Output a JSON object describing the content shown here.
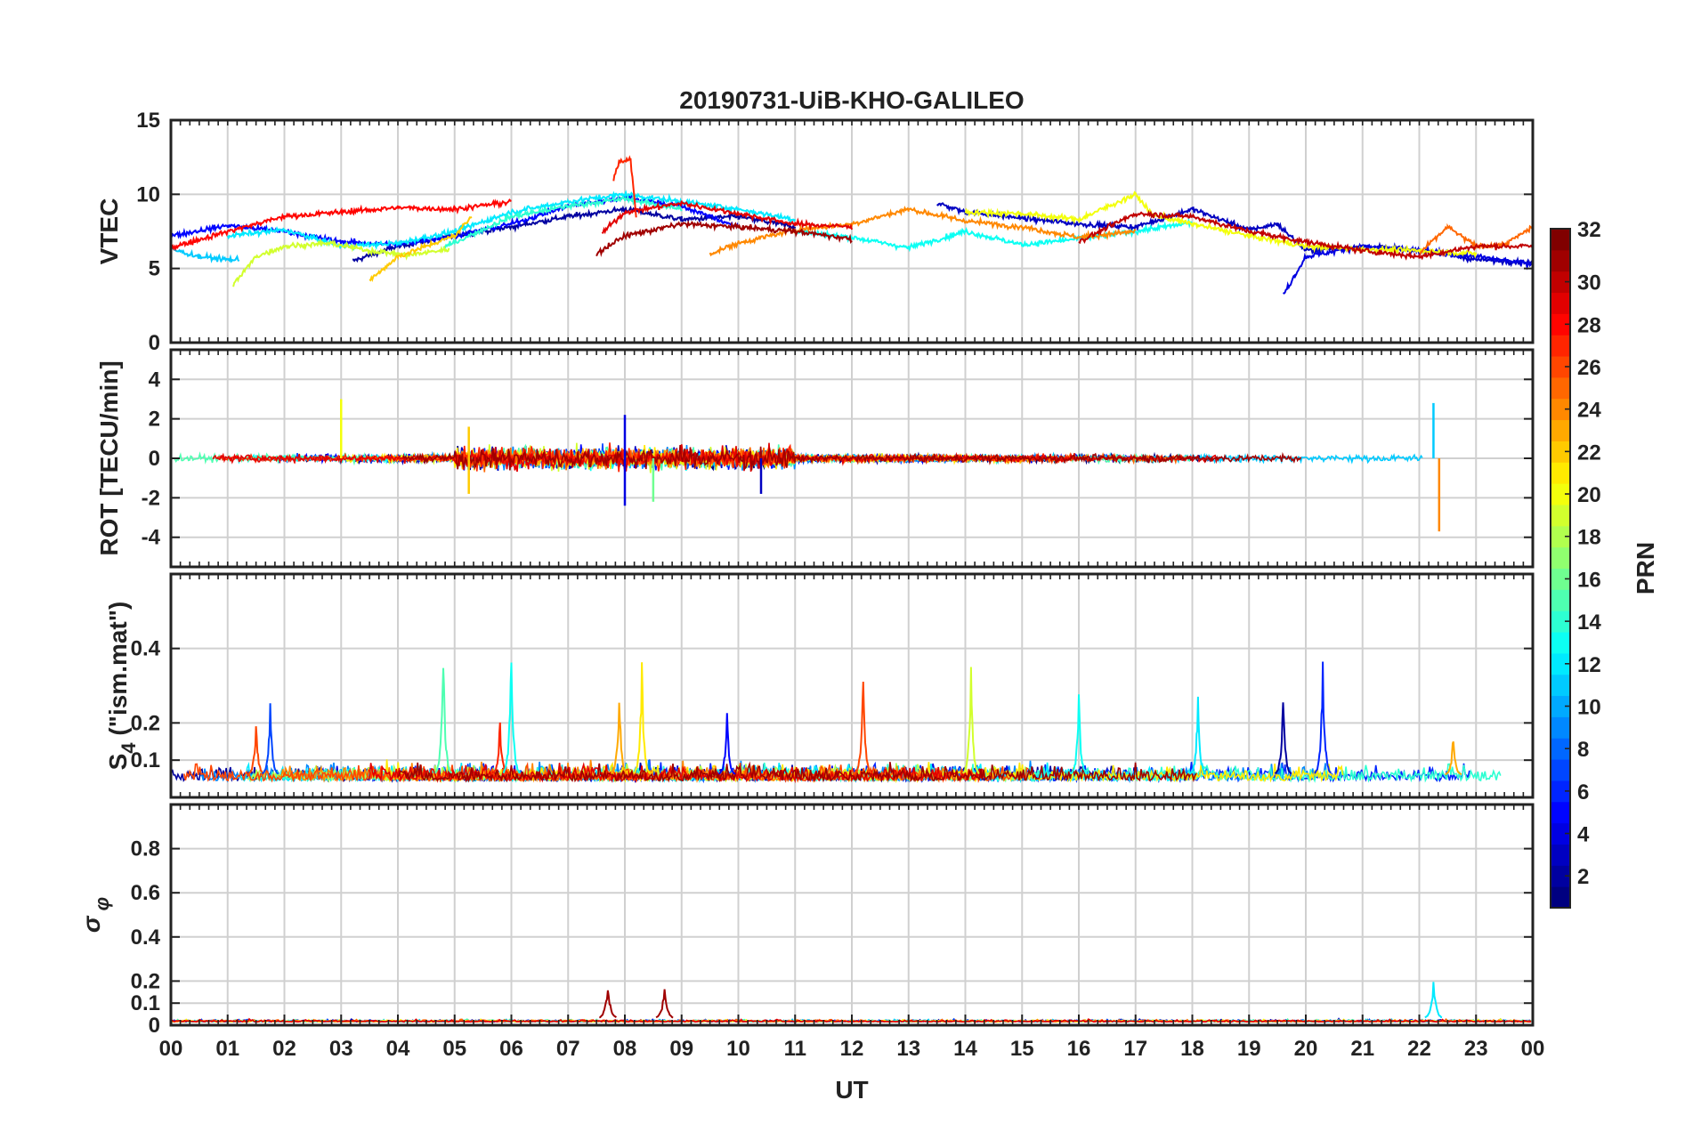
{
  "figure": {
    "title": "20190731-UiB-KHO-GALILEO",
    "xlabel": "UT",
    "x_tick_labels": [
      "00",
      "01",
      "02",
      "03",
      "04",
      "05",
      "06",
      "07",
      "08",
      "09",
      "10",
      "11",
      "12",
      "13",
      "14",
      "15",
      "16",
      "17",
      "18",
      "19",
      "20",
      "21",
      "22",
      "23",
      "00"
    ]
  },
  "colorbar": {
    "label": "PRN",
    "range": [
      1,
      32
    ],
    "tick_labels": [
      "2",
      "4",
      "6",
      "8",
      "10",
      "12",
      "14",
      "16",
      "18",
      "20",
      "22",
      "24",
      "26",
      "28",
      "30",
      "32"
    ],
    "colormap": "jet",
    "colors": [
      "#00008f",
      "#0000ff",
      "#0080ff",
      "#00ffff",
      "#80ff80",
      "#ffff00",
      "#ff8000",
      "#ff0000",
      "#800000"
    ]
  },
  "chart_data": [
    {
      "type": "line",
      "panel": "VTEC",
      "ylabel": "VTEC",
      "ylim": [
        0,
        15
      ],
      "y_ticks": [
        0,
        5,
        10,
        15
      ],
      "xlim": [
        0,
        24
      ],
      "grid": true,
      "series": [
        {
          "prn": 2,
          "x": [
            3.2,
            4,
            5,
            6,
            7,
            8,
            9,
            10,
            11
          ],
          "y": [
            5.5,
            6.5,
            7.2,
            7.8,
            8.5,
            9,
            8.3,
            8.5,
            7.8
          ]
        },
        {
          "prn": 3,
          "x": [
            13.5,
            14,
            15,
            16,
            17,
            18,
            19,
            19.5,
            20,
            21,
            22,
            23,
            24
          ],
          "y": [
            9.4,
            8.8,
            8.4,
            8,
            7.8,
            9,
            7.6,
            8,
            6.2,
            6.5,
            6.2,
            5.6,
            5.4
          ]
        },
        {
          "prn": 4,
          "x": [
            19.6,
            19.8,
            20,
            21,
            22,
            23,
            24
          ],
          "y": [
            3.2,
            4.5,
            5.8,
            6.5,
            6.2,
            5.8,
            5.3
          ]
        },
        {
          "prn": 5,
          "x": [
            0,
            1,
            2,
            3,
            4,
            5,
            6,
            7,
            8,
            9,
            10
          ],
          "y": [
            7.2,
            7.9,
            7.5,
            6.8,
            6.6,
            7.2,
            8,
            9.2,
            9.8,
            9.2,
            7.8
          ]
        },
        {
          "prn": 11,
          "x": [
            0,
            0.5,
            1,
            1.2
          ],
          "y": [
            6.3,
            5.8,
            5.6,
            5.6
          ]
        },
        {
          "prn": 12,
          "x": [
            1,
            2,
            3,
            4,
            5,
            6,
            7,
            8,
            9,
            10,
            11
          ],
          "y": [
            7.2,
            7.6,
            6.5,
            6.7,
            7.5,
            8.8,
            9.5,
            10,
            9.5,
            9,
            8.3
          ]
        },
        {
          "prn": 13,
          "x": [
            11,
            12,
            13,
            14,
            15,
            16,
            17,
            18
          ],
          "y": [
            7.5,
            7.1,
            6.4,
            7.5,
            6.6,
            7,
            7.5,
            8.1
          ]
        },
        {
          "prn": 14,
          "x": [
            4.8,
            6,
            7,
            8,
            9
          ],
          "y": [
            6.4,
            8.5,
            9.2,
            9.7,
            9
          ]
        },
        {
          "prn": 19,
          "x": [
            1.1,
            1.5,
            2,
            2.8,
            3.5,
            4.2,
            4.9
          ],
          "y": [
            3.9,
            5.8,
            6.5,
            6.7,
            6.2,
            5.9,
            6.3
          ]
        },
        {
          "prn": 20,
          "x": [
            14,
            15,
            16,
            17,
            17.3,
            18,
            19,
            20,
            21,
            22,
            23
          ],
          "y": [
            8.8,
            8.7,
            8.3,
            10,
            8.6,
            8,
            7.2,
            6.5,
            6.3,
            6.2,
            6
          ]
        },
        {
          "prn": 22,
          "x": [
            3.5,
            4,
            5,
            5.3
          ],
          "y": [
            4.2,
            5.8,
            7.2,
            8.5
          ]
        },
        {
          "prn": 24,
          "x": [
            9.5,
            10,
            11,
            12,
            13,
            14,
            15,
            16,
            17
          ],
          "y": [
            6,
            6.7,
            7.6,
            8,
            9,
            8.2,
            7.8,
            7.1,
            7.5
          ]
        },
        {
          "prn": 25,
          "x": [
            22,
            22.5,
            23,
            23.5,
            24
          ],
          "y": [
            6,
            7.8,
            6.5,
            6.6,
            7.8
          ]
        },
        {
          "prn": 27,
          "x": [
            7.8,
            7.9,
            8.1,
            8.2
          ],
          "y": [
            11,
            12.2,
            12.3,
            8.5
          ]
        },
        {
          "prn": 28,
          "x": [
            0,
            1,
            2,
            3,
            4,
            5,
            6
          ],
          "y": [
            6.4,
            7.5,
            8.5,
            8.8,
            9.1,
            9,
            9.5
          ]
        },
        {
          "prn": 29,
          "x": [
            7.6,
            8,
            9,
            10,
            11,
            12
          ],
          "y": [
            7.4,
            8.8,
            9.4,
            8.7,
            8,
            7.8
          ]
        },
        {
          "prn": 31,
          "x": [
            7.5,
            8,
            9,
            10,
            11,
            12
          ],
          "y": [
            6,
            7.2,
            8,
            7.8,
            7.5,
            7
          ]
        },
        {
          "prn": 30,
          "x": [
            16,
            17,
            18,
            19,
            20,
            21,
            22,
            23,
            24
          ],
          "y": [
            6.8,
            8.7,
            8.5,
            7.5,
            6.8,
            6.2,
            5.8,
            6.5,
            6.5
          ]
        }
      ]
    },
    {
      "type": "line",
      "panel": "ROT",
      "ylabel": "ROT [TECU/min]",
      "ylim": [
        -5.5,
        5.5
      ],
      "y_ticks": [
        -4,
        -2,
        0,
        2,
        4
      ],
      "xlim": [
        0,
        24
      ],
      "grid": true,
      "spikes": [
        {
          "prn": 20,
          "x": 3.0,
          "y": 3.0
        },
        {
          "prn": 22,
          "x": 5.25,
          "y": 1.6
        },
        {
          "prn": 22,
          "x": 5.25,
          "y": -1.8
        },
        {
          "prn": 4,
          "x": 8.0,
          "y": 2.2
        },
        {
          "prn": 4,
          "x": 8.0,
          "y": -2.4
        },
        {
          "prn": 16,
          "x": 8.5,
          "y": -2.2
        },
        {
          "prn": 3,
          "x": 10.4,
          "y": -1.8
        },
        {
          "prn": 11,
          "x": 22.25,
          "y": 2.8
        },
        {
          "prn": 24,
          "x": 22.35,
          "y": -3.7
        }
      ]
    },
    {
      "type": "line",
      "panel": "S4",
      "ylabel": "S4 (\"ism.mat\")",
      "ylim": [
        0,
        0.6
      ],
      "y_ticks": [
        0.1,
        0.2,
        0.4
      ],
      "xlim": [
        0,
        24
      ],
      "grid": true,
      "peaks": [
        {
          "prn": 26,
          "x": 1.5,
          "y": 0.22
        },
        {
          "prn": 7,
          "x": 1.75,
          "y": 0.27
        },
        {
          "prn": 15,
          "x": 4.8,
          "y": 0.41
        },
        {
          "prn": 27,
          "x": 5.8,
          "y": 0.22
        },
        {
          "prn": 13,
          "x": 6.0,
          "y": 0.44
        },
        {
          "prn": 23,
          "x": 7.9,
          "y": 0.3
        },
        {
          "prn": 21,
          "x": 8.3,
          "y": 0.37
        },
        {
          "prn": 5,
          "x": 9.8,
          "y": 0.24
        },
        {
          "prn": 26,
          "x": 12.2,
          "y": 0.36
        },
        {
          "prn": 19,
          "x": 14.1,
          "y": 0.36
        },
        {
          "prn": 13,
          "x": 16.0,
          "y": 0.28
        },
        {
          "prn": 12,
          "x": 18.1,
          "y": 0.28
        },
        {
          "prn": 2,
          "x": 19.6,
          "y": 0.29
        },
        {
          "prn": 6,
          "x": 20.3,
          "y": 0.38
        },
        {
          "prn": 23,
          "x": 22.6,
          "y": 0.18
        }
      ]
    },
    {
      "type": "line",
      "panel": "sigma_phi",
      "ylabel": "σ φ",
      "ylim": [
        0,
        1
      ],
      "y_ticks": [
        0,
        0.1,
        0.2,
        0.4,
        0.6,
        0.8
      ],
      "xlim": [
        0,
        24
      ],
      "grid": true,
      "peaks": [
        {
          "prn": 31,
          "x": 7.7,
          "y": 0.2
        },
        {
          "prn": 31,
          "x": 8.7,
          "y": 0.19
        },
        {
          "prn": 12,
          "x": 22.25,
          "y": 0.21
        }
      ]
    }
  ]
}
